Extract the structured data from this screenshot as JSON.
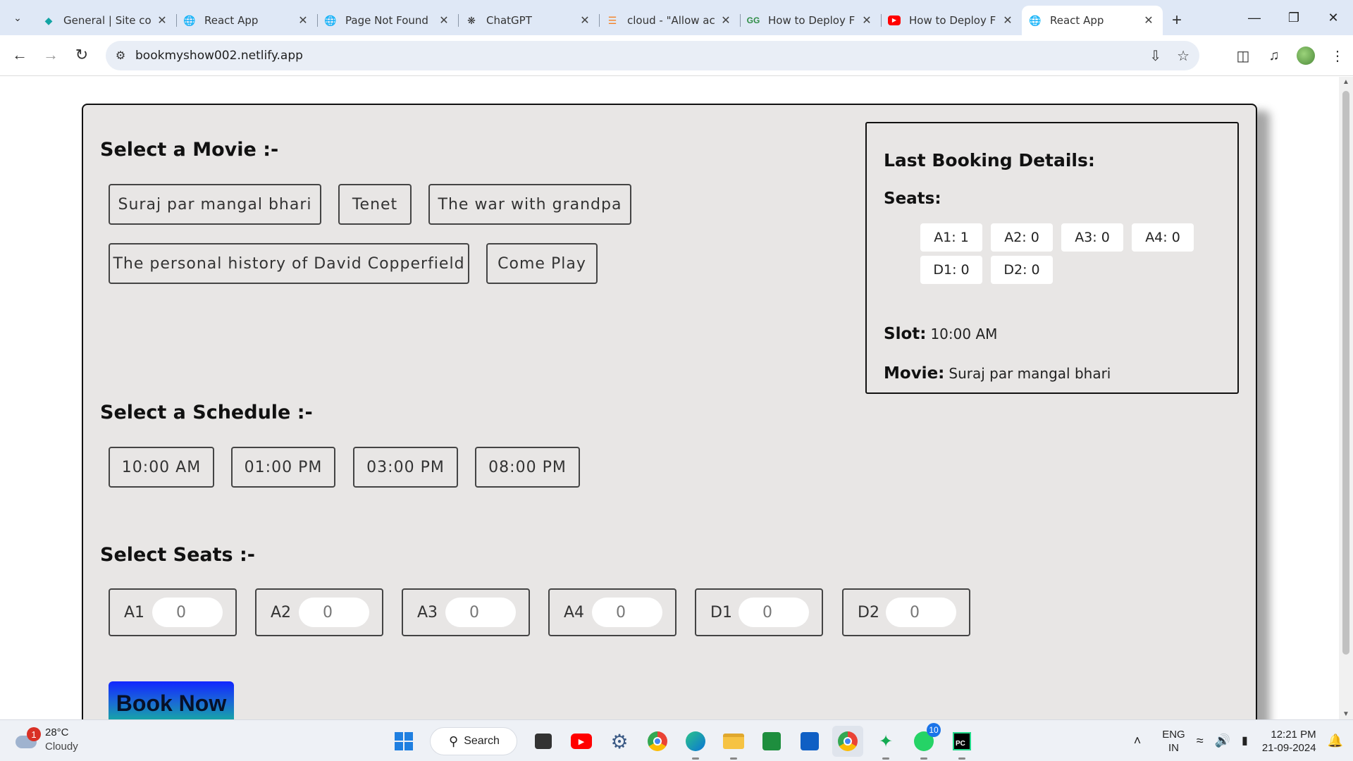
{
  "browser": {
    "tabs": [
      {
        "title": "General | Site co",
        "icon": "diamond-icon",
        "color": "#12a4a4"
      },
      {
        "title": "React App",
        "icon": "globe-icon",
        "color": "#555555"
      },
      {
        "title": "Page Not Found",
        "icon": "globe-icon",
        "color": "#555555"
      },
      {
        "title": "ChatGPT",
        "icon": "openai-icon",
        "color": "#333333"
      },
      {
        "title": "cloud - \"Allow ac",
        "icon": "stackoverflow-icon",
        "color": "#f48024"
      },
      {
        "title": "How to Deploy F",
        "icon": "gfg-icon",
        "color": "#2f8d46"
      },
      {
        "title": "How to Deploy F",
        "icon": "youtube-icon",
        "color": "#ff0000"
      },
      {
        "title": "React App",
        "icon": "globe-icon",
        "color": "#555555"
      }
    ],
    "url": "bookmyshow002.netlify.app"
  },
  "app": {
    "movie_title": "Select a Movie :-",
    "movies": [
      "Suraj par mangal bhari",
      "Tenet",
      "The war with grandpa",
      "The personal history of David Copperfield",
      "Come Play"
    ],
    "schedule_title": "Select a Schedule :-",
    "slots": [
      "10:00 AM",
      "01:00 PM",
      "03:00 PM",
      "08:00 PM"
    ],
    "seats_title": "Select Seats :-",
    "seats": [
      {
        "label": "A1",
        "value": "0"
      },
      {
        "label": "A2",
        "value": "0"
      },
      {
        "label": "A3",
        "value": "0"
      },
      {
        "label": "A4",
        "value": "0"
      },
      {
        "label": "D1",
        "value": "0"
      },
      {
        "label": "D2",
        "value": "0"
      }
    ],
    "book_label": "Book Now",
    "last_booking": {
      "title": "Last Booking Details:",
      "seats_label": "Seats:",
      "seats": [
        "A1: 1",
        "A2: 0",
        "A3: 0",
        "A4: 0",
        "D1: 0",
        "D2: 0"
      ],
      "slot_label": "Slot:",
      "slot_value": "10:00 AM",
      "movie_label": "Movie:",
      "movie_value": "Suraj par mangal bhari"
    }
  },
  "taskbar": {
    "weather_temp": "28°C",
    "weather_desc": "Cloudy",
    "weather_badge": "1",
    "search_label": "Search",
    "whatsapp_badge": "10",
    "lang_top": "ENG",
    "lang_bottom": "IN",
    "time": "12:21 PM",
    "date": "21-09-2024"
  },
  "colors": {
    "card_bg": "#e8e6e5",
    "book_gradient_top": "#1226ff",
    "book_gradient_bottom": "#16b59a"
  }
}
